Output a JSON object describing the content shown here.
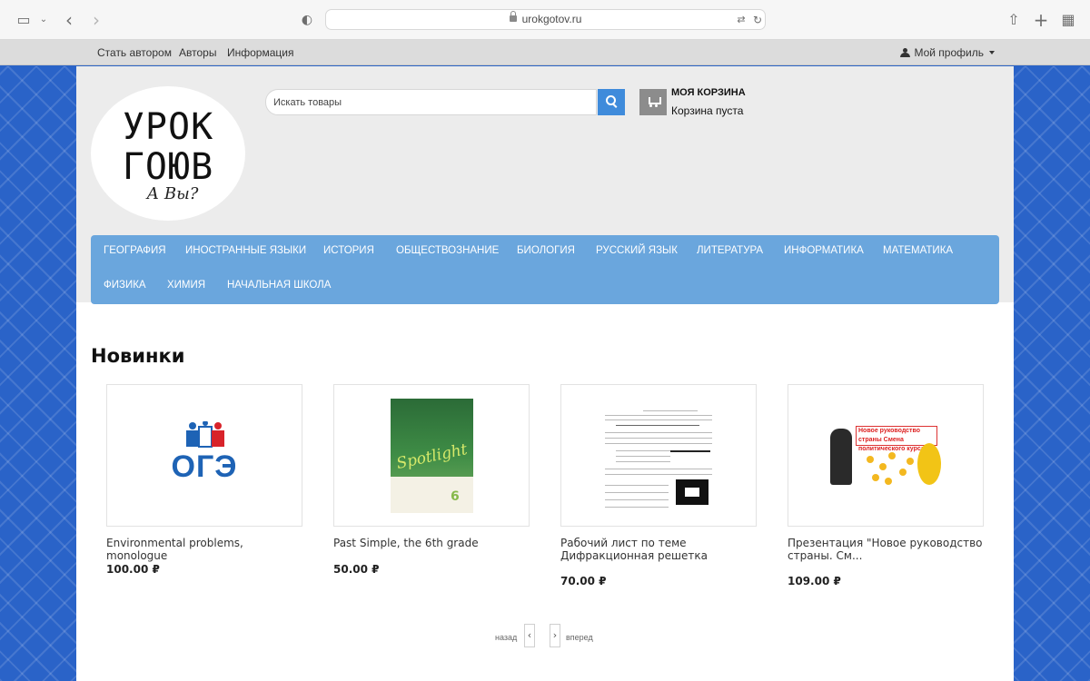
{
  "browser": {
    "url": "urokgotov.ru"
  },
  "topbar": {
    "links": [
      "Стать автором",
      "Авторы",
      "Информация"
    ],
    "profile_label": "Мой профиль"
  },
  "logo": {
    "line1": "УРОК",
    "line2": "ГОЮВ",
    "line3": "А Вы?"
  },
  "search": {
    "placeholder": "Искать товары"
  },
  "cart": {
    "title": "МОЯ КОРЗИНА",
    "status": "Корзина пуста"
  },
  "categories": [
    "География",
    "Иностранные языки",
    "История",
    "Обществознание",
    "Биология",
    "Русский язык",
    "Литература",
    "Информатика",
    "Математика",
    "Физика",
    "Химия",
    "Начальная школа"
  ],
  "section": {
    "title": "Новинки"
  },
  "products": [
    {
      "name": "Environmental problems, monologue",
      "price": "100.00 ₽",
      "thumb_text": "ОГЭ"
    },
    {
      "name": "Past Simple, the 6th grade",
      "price": "50.00 ₽",
      "thumb_text": "Spotlight",
      "thumb_num": "6"
    },
    {
      "name": "Рабочий лист по теме Дифракционная решетка",
      "price": "70.00 ₽"
    },
    {
      "name": "Презентация \"Новое руководство страны. См...",
      "price": "109.00 ₽",
      "thumb_text": "Новое руководство страны Смена политического курса"
    }
  ],
  "pagination": {
    "back_label": "назад",
    "forward_label": "вперед"
  },
  "colors": {
    "accent_blue": "#3f8bdb",
    "menu_blue": "#6aa6dd",
    "background_blue": "#2a63c8"
  }
}
